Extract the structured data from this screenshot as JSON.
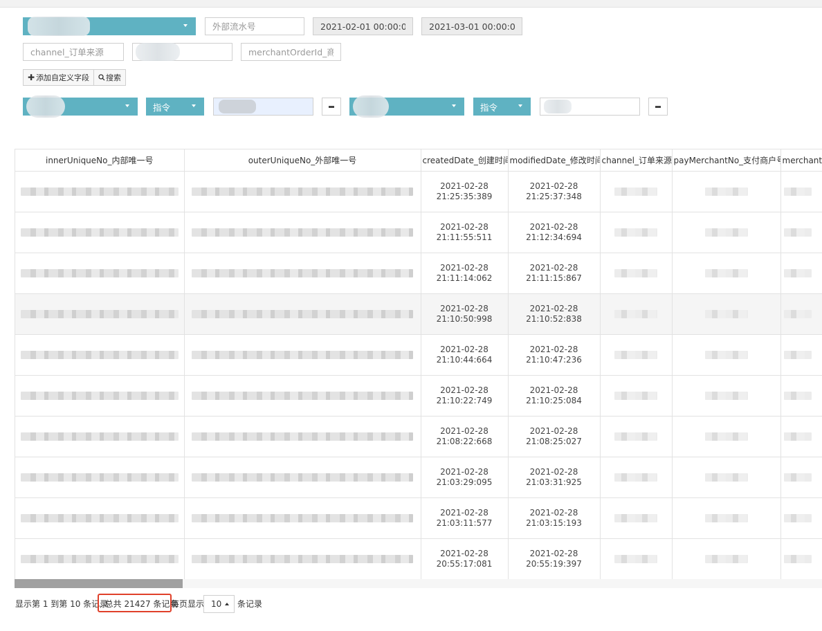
{
  "filters": {
    "row1": {
      "select_value": "",
      "outer_serial_placeholder": "外部流水号",
      "start_date": "2021-02-01 00:00:00",
      "end_date": "2021-03-01 00:00:00"
    },
    "row2": {
      "channel_placeholder": "channel_订单来源",
      "merchant_order_placeholder": "merchantOrderId_商户"
    },
    "add_field_label": "添加自定义字段",
    "search_label": "搜索",
    "conditions": [
      {
        "field_value": "",
        "operator": "指令"
      },
      {
        "field_value": "",
        "operator": "指令"
      }
    ]
  },
  "table": {
    "columns": [
      "innerUniqueNo_内部唯一号",
      "outerUniqueNo_外部唯一号",
      "createdDate_创建时间",
      "modifiedDate_修改时间",
      "channel_订单来源",
      "payMerchantNo_支付商户号",
      "merchantOrderId_商户"
    ],
    "rows": [
      {
        "created": [
          "2021-02-28",
          "21:25:35:389"
        ],
        "modified": [
          "2021-02-28",
          "21:25:37:348"
        ]
      },
      {
        "created": [
          "2021-02-28",
          "21:11:55:511"
        ],
        "modified": [
          "2021-02-28",
          "21:12:34:694"
        ]
      },
      {
        "created": [
          "2021-02-28",
          "21:11:14:062"
        ],
        "modified": [
          "2021-02-28",
          "21:11:15:867"
        ]
      },
      {
        "created": [
          "2021-02-28",
          "21:10:50:998"
        ],
        "modified": [
          "2021-02-28",
          "21:10:52:838"
        ]
      },
      {
        "created": [
          "2021-02-28",
          "21:10:44:664"
        ],
        "modified": [
          "2021-02-28",
          "21:10:47:236"
        ]
      },
      {
        "created": [
          "2021-02-28",
          "21:10:22:749"
        ],
        "modified": [
          "2021-02-28",
          "21:10:25:084"
        ]
      },
      {
        "created": [
          "2021-02-28",
          "21:08:22:668"
        ],
        "modified": [
          "2021-02-28",
          "21:08:25:027"
        ]
      },
      {
        "created": [
          "2021-02-28",
          "21:03:29:095"
        ],
        "modified": [
          "2021-02-28",
          "21:03:31:925"
        ]
      },
      {
        "created": [
          "2021-02-28",
          "21:03:11:577"
        ],
        "modified": [
          "2021-02-28",
          "21:03:15:193"
        ]
      },
      {
        "created": [
          "2021-02-28",
          "20:55:17:081"
        ],
        "modified": [
          "2021-02-28",
          "20:55:19:397"
        ]
      }
    ]
  },
  "pagination": {
    "range_text": "显示第 1 到第 10 条记录",
    "total_text": ", 总共 21427 条记录",
    "per_page_prefix": "每页显示",
    "page_size": "10",
    "per_page_suffix": "条记录"
  },
  "colors": {
    "accent": "#5fb2c2",
    "highlight_border": "#e0402a"
  },
  "icons": {
    "add": "plus-icon",
    "search": "search-icon",
    "dropdown": "caret-down-icon",
    "remove": "minus-icon",
    "page_size_toggle": "caret-up-icon"
  }
}
